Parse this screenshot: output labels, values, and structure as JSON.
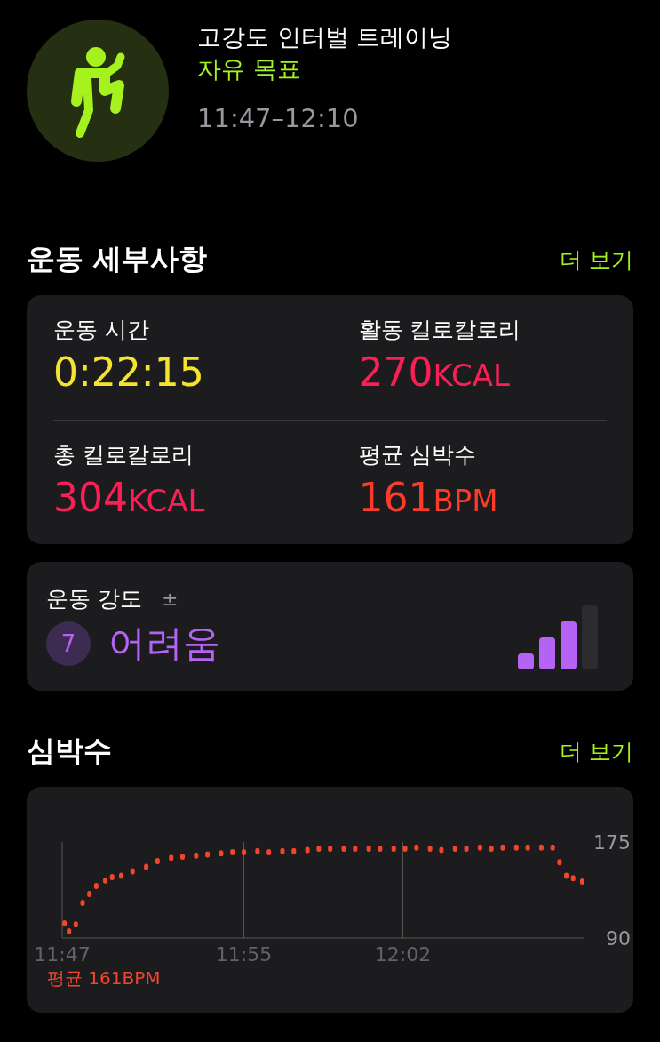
{
  "workout": {
    "title": "고강도 인터벌 트레이닝",
    "goal": "자유 목표",
    "time_range": "11:47–12:10"
  },
  "details": {
    "title": "운동 세부사항",
    "more": "더 보기",
    "metrics": [
      {
        "label": "운동 시간",
        "value": "0:22:15",
        "color": "#f5e42f"
      },
      {
        "label": "활동 킬로칼로리",
        "value": "270",
        "unit": "KCAL",
        "color": "#fa1f55"
      },
      {
        "label": "총 킬로칼로리",
        "value": "304",
        "unit": "KCAL",
        "color": "#fa1f55"
      },
      {
        "label": "평균 심박수",
        "value": "161",
        "unit": "BPM",
        "color": "#fe3b2a"
      }
    ]
  },
  "intensity": {
    "label": "운동 강도",
    "info": "±",
    "score": "7",
    "value": "어려움",
    "meter": [
      {
        "on": true
      },
      {
        "on": true
      },
      {
        "on": true
      },
      {
        "on": false
      }
    ]
  },
  "heart_rate": {
    "title": "심박수",
    "more": "더 보기",
    "average": "평균 161BPM",
    "chart_data": {
      "type": "scatter",
      "xlim": [
        707,
        730
      ],
      "ylim": [
        90,
        175
      ],
      "xticks": [
        {
          "value": 707,
          "label": "11:47"
        },
        {
          "value": 715,
          "label": "11:55"
        },
        {
          "value": 722,
          "label": "12:02"
        }
      ],
      "yticks": [
        90,
        175
      ],
      "x": [
        707.1,
        707.3,
        707.6,
        707.9,
        708.2,
        708.5,
        708.9,
        709.2,
        709.6,
        710.1,
        710.7,
        711.2,
        711.8,
        712.3,
        712.9,
        713.4,
        714.0,
        714.5,
        715.0,
        715.6,
        716.1,
        716.7,
        717.2,
        717.8,
        718.3,
        718.8,
        719.4,
        719.9,
        720.5,
        721.0,
        721.6,
        722.1,
        722.6,
        723.2,
        723.7,
        724.3,
        724.8,
        725.4,
        725.9,
        726.4,
        727.0,
        727.5,
        728.1,
        728.6,
        728.9,
        729.2,
        729.5,
        729.9
      ],
      "series": [
        {
          "color": "#f2452c",
          "values": [
            103,
            96,
            102,
            121,
            129,
            136,
            141,
            144,
            145,
            149,
            153,
            158,
            161,
            162,
            163,
            164,
            165,
            166,
            166,
            167,
            166,
            167,
            167,
            168,
            169,
            169,
            169,
            169,
            169,
            169,
            169,
            169,
            170,
            169,
            168,
            169,
            169,
            170,
            169,
            170,
            170,
            170,
            170,
            170,
            157,
            145,
            143,
            140
          ]
        }
      ]
    }
  }
}
